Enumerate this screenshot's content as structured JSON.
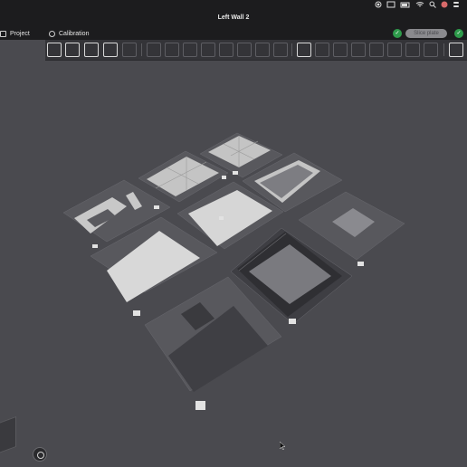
{
  "window": {
    "title": "Left Wall 2"
  },
  "tabs": [
    {
      "label": "Project",
      "icon": "panel-icon"
    },
    {
      "label": "Calibration",
      "icon": "target-icon"
    }
  ],
  "toolbar": {
    "slice_label": "Slice plate"
  },
  "plates": [
    {
      "name": "plate-1"
    },
    {
      "name": "plate-2"
    },
    {
      "name": "plate-3"
    },
    {
      "name": "plate-4"
    },
    {
      "name": "plate-5"
    },
    {
      "name": "plate-6"
    },
    {
      "name": "plate-7"
    },
    {
      "name": "plate-8"
    },
    {
      "name": "plate-9"
    }
  ],
  "colors": {
    "accent_green": "#2e9b4b",
    "background": "#4a4a4f",
    "bar": "#1c1c1e"
  }
}
